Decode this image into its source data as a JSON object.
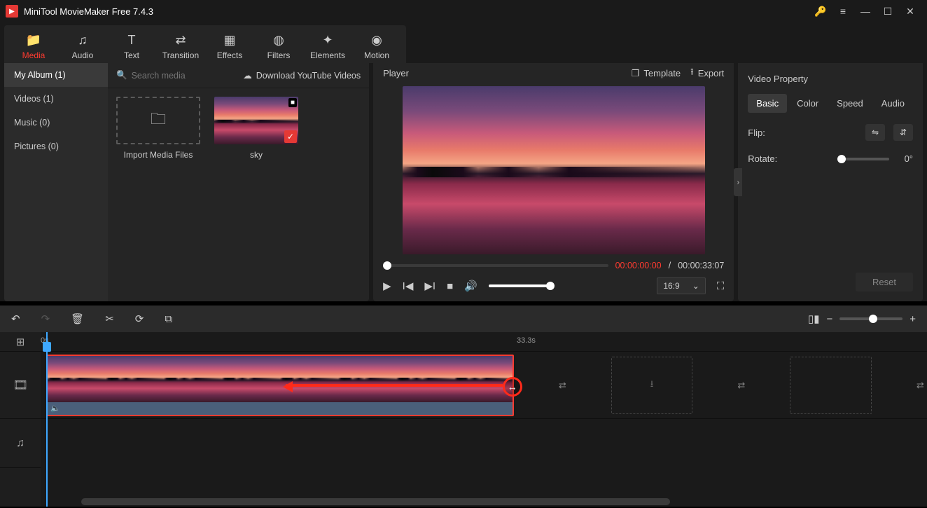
{
  "app": {
    "title": "MiniTool MovieMaker Free 7.4.3"
  },
  "tabs": {
    "media": "Media",
    "audio": "Audio",
    "text": "Text",
    "transition": "Transition",
    "effects": "Effects",
    "filters": "Filters",
    "elements": "Elements",
    "motion": "Motion"
  },
  "sidebar": {
    "album": "My Album (1)",
    "videos": "Videos (1)",
    "music": "Music (0)",
    "pictures": "Pictures (0)"
  },
  "media": {
    "search_placeholder": "Search media",
    "download": "Download YouTube Videos",
    "import": "Import Media Files",
    "clip1": "sky"
  },
  "player": {
    "title": "Player",
    "template": "Template",
    "export": "Export",
    "time_current": "00:00:00:00",
    "time_sep": " / ",
    "time_duration": "00:00:33:07",
    "aspect": "16:9"
  },
  "props": {
    "title": "Video Property",
    "tab_basic": "Basic",
    "tab_color": "Color",
    "tab_speed": "Speed",
    "tab_audio": "Audio",
    "flip": "Flip:",
    "rotate": "Rotate:",
    "rotate_value": "0°",
    "reset": "Reset"
  },
  "timeline": {
    "tick0": "0s",
    "tick1": "33.3s",
    "clip_duration": "33.3s"
  }
}
